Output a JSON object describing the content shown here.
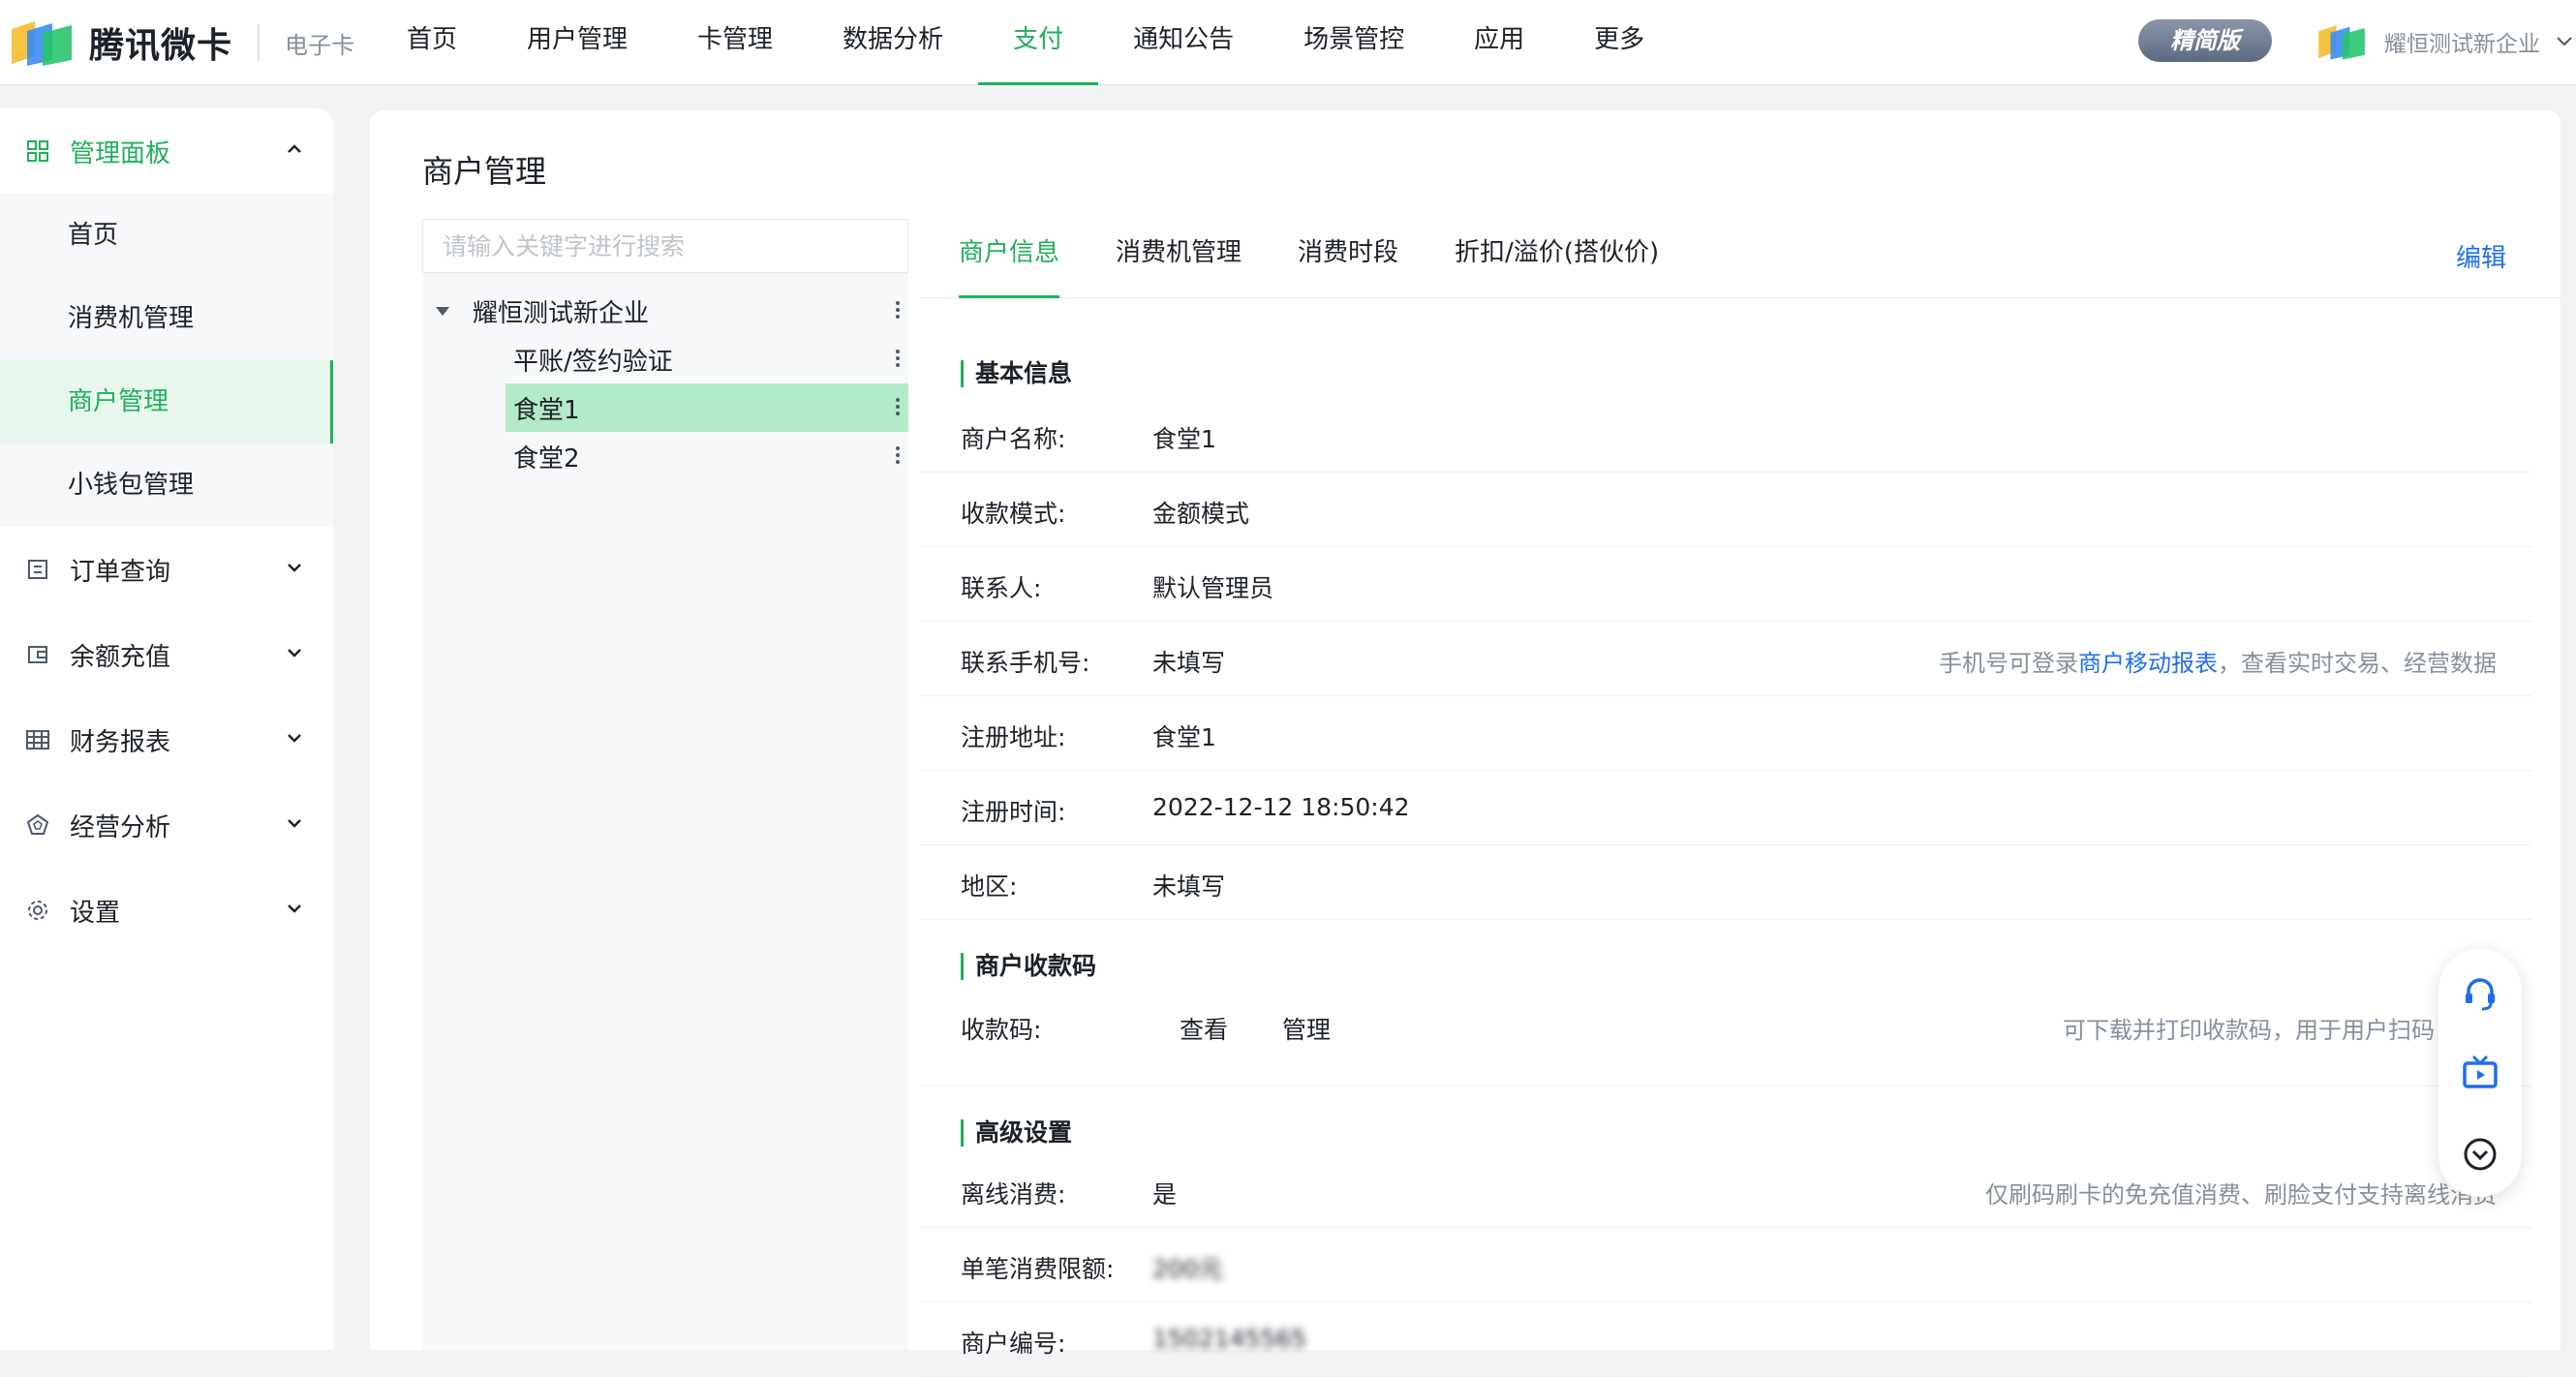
{
  "brand": {
    "name": "腾讯微卡",
    "product": "电子卡",
    "edition": "精简版"
  },
  "colors": {
    "accent": "#20b05a",
    "link": "#1e6ef0",
    "selected_bg": "#b3ebc8"
  },
  "nav": [
    "首页",
    "用户管理",
    "卡管理",
    "数据分析",
    "支付",
    "通知公告",
    "场景管控",
    "应用",
    "更多"
  ],
  "nav_active": "支付",
  "user": {
    "name": "耀恒测试新企业"
  },
  "sidebar": {
    "panel": {
      "label": "管理面板",
      "items": [
        "首页",
        "消费机管理",
        "商户管理",
        "小钱包管理"
      ],
      "active": "商户管理"
    },
    "groups": [
      {
        "label": "订单查询",
        "icon": "list-icon"
      },
      {
        "label": "余额充值",
        "icon": "wallet-icon"
      },
      {
        "label": "财务报表",
        "icon": "table-icon"
      },
      {
        "label": "经营分析",
        "icon": "analysis-icon"
      },
      {
        "label": "设置",
        "icon": "gear-icon"
      }
    ]
  },
  "page": {
    "title": "商户管理"
  },
  "tree": {
    "search_placeholder": "请输入关键字进行搜索",
    "root": "耀恒测试新企业",
    "children": [
      "平账/签约验证",
      "食堂1",
      "食堂2"
    ],
    "selected": "食堂1"
  },
  "tabs": [
    "商户信息",
    "消费机管理",
    "消费时段",
    "折扣/溢价(搭伙价)"
  ],
  "tab_active": "商户信息",
  "edit_label": "编辑",
  "basic": {
    "title": "基本信息",
    "rows": [
      {
        "label": "商户名称:",
        "value": "食堂1"
      },
      {
        "label": "收款模式:",
        "value": "金额模式"
      },
      {
        "label": "联系人:",
        "value": "默认管理员"
      },
      {
        "label": "联系手机号:",
        "value": "未填写",
        "hint_pre": "手机号可登录",
        "hint_link": "商户移动报表",
        "hint_post": "，查看实时交易、经营数据"
      },
      {
        "label": "注册地址:",
        "value": "食堂1"
      },
      {
        "label": "注册时间:",
        "value": "2022-12-12 18:50:42"
      },
      {
        "label": "地区:",
        "value": "未填写"
      }
    ]
  },
  "qrcode": {
    "title": "商户收款码",
    "label": "收款码:",
    "view": "查看",
    "manage": "管理",
    "hint": "可下载并打印收款码，用于用户扫码"
  },
  "advanced": {
    "title": "高级设置",
    "rows": [
      {
        "label": "离线消费:",
        "value": "是",
        "hint": "仅刷码刷卡的免充值消费、刷脸支付支持离线消费"
      },
      {
        "label": "单笔消费限额:",
        "value": "200元"
      },
      {
        "label": "商户编号:",
        "value": "1502145565"
      }
    ]
  },
  "float_buttons": [
    "headset-icon",
    "tv-icon",
    "chevron-down-circle-icon"
  ]
}
